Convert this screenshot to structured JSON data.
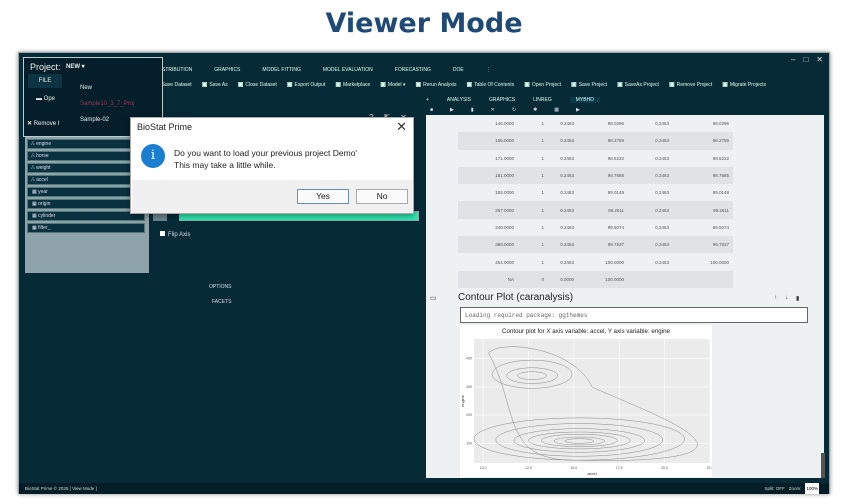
{
  "page_title": "Viewer Mode",
  "nav": [
    "DISTRIBUTION",
    "GRAPHICS",
    "MODEL FITTING",
    "MODEL EVALUATION",
    "FORECASTING",
    "DOE",
    "⋮"
  ],
  "toolbar": [
    "Save Dataset",
    "Save As",
    "Close Dataset",
    "Export Output",
    "Marketplace",
    "Model ▾",
    "Rerun Analysis",
    "Table Of Contents",
    "Open Project",
    "Save Project",
    "SaveAs Project",
    "Remove Project",
    "Migrate Projects"
  ],
  "project": {
    "label": "Project:",
    "selected": "NEW ▾",
    "file_tab": "FILE",
    "open": "Ope",
    "remove": "Remove I",
    "options": [
      "New",
      "Sample10_3_7_Proj",
      "Sample-02"
    ]
  },
  "variables": [
    "engine",
    "horse",
    "weight",
    "accel",
    "year",
    "origin",
    "cylinder",
    "filter_"
  ],
  "middle": {
    "flip_axis": "Flip Axis",
    "options": "OPTIONS",
    "facets": "FACETS"
  },
  "dialog": {
    "title": "BioStat Prime",
    "line1": "Do you want to load your previous project Demo'",
    "line2": "This may take a little while.",
    "yes": "Yes",
    "no": "No"
  },
  "output_tabs": [
    "+",
    "ANALYSIS",
    "GRAPHICS",
    "LINREG",
    "MYBHD"
  ],
  "table_rows": [
    [
      "146.0000",
      "1",
      "0.2463",
      "98.0296",
      "0.2463",
      "98.0296"
    ],
    [
      "155.0000",
      "1",
      "0.2463",
      "98.2759",
      "0.2463",
      "98.2759"
    ],
    [
      "171.0000",
      "1",
      "0.2463",
      "98.5222",
      "0.2463",
      "98.5222"
    ],
    [
      "181.0000",
      "1",
      "0.2463",
      "98.7685",
      "0.2463",
      "98.7685"
    ],
    [
      "183.0000",
      "1",
      "0.2463",
      "99.0148",
      "0.2463",
      "99.0148"
    ],
    [
      "267.0000",
      "1",
      "0.2463",
      "99.2611",
      "0.2463",
      "99.2611"
    ],
    [
      "340.0000",
      "1",
      "0.2463",
      "99.5074",
      "0.2463",
      "99.5074"
    ],
    [
      "390.0000",
      "1",
      "0.2463",
      "99.7537",
      "0.2463",
      "99.7537"
    ],
    [
      "454.0000",
      "1",
      "0.2463",
      "100.0000",
      "0.2463",
      "100.0000"
    ],
    [
      "NA",
      "0",
      "0.0000",
      "100.0000",
      "",
      ""
    ]
  ],
  "contour": {
    "heading": "Contour Plot (caranalysis)",
    "console": "Loading required package: ggthemes"
  },
  "chart_data": {
    "type": "contour",
    "title": "Contour plot  for X axis variable: accel, Y axis variable: engine",
    "xlabel": "accel",
    "ylabel": "engine",
    "xticks": [
      "10.0",
      "12.5",
      "15.0",
      "17.5",
      "20.0",
      "22.5"
    ],
    "yticks": [
      "100",
      "200",
      "300",
      "400"
    ],
    "xlim": [
      9.5,
      22.5
    ],
    "ylim": [
      30,
      470
    ]
  },
  "status": {
    "left": "BioStat Prime © 2025    [ View Mode ]",
    "split": "Split: OFF",
    "zoom_label": "Zoom:",
    "zoom": "100%"
  }
}
